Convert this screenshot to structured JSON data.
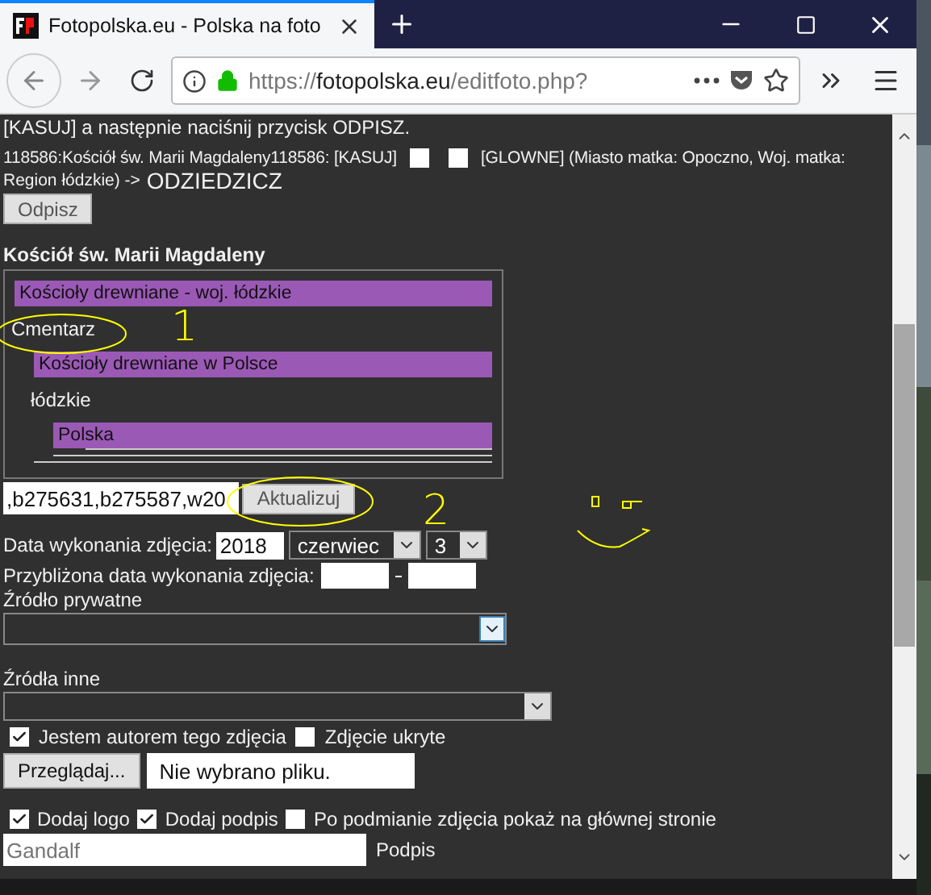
{
  "browser": {
    "tab_title": "Fotopolska.eu - Polska na foto",
    "url": {
      "scheme": "https://",
      "domain": "fotopolska.eu",
      "path": "/editfoto.php?"
    }
  },
  "page": {
    "intro_line": "[KASUJ] a następnie naciśnij przycisk ODPISZ.",
    "record": {
      "text": "118586:Kościół św. Marii Magdaleny118586: [KASUJ]",
      "boxes": [
        {
          "checked": false
        },
        {
          "checked": false
        }
      ],
      "tail": "[GLOWNE] (Miasto matka: Opoczno, Woj. matka:",
      "tail_2": "Region łódzkie) ->",
      "link": "ODZIEDZICZ"
    },
    "odpisz_button": "Odpisz",
    "heading": "Kościół św. Marii Magdaleny",
    "categories": [
      {
        "label": "Kościoły drewniane - woj. łódzkie",
        "note": "Cmentarz",
        "children": [
          {
            "label": "Kościoły drewniane w Polsce",
            "note": "łódzkie",
            "children": [
              {
                "label": "Polska"
              }
            ]
          }
        ]
      }
    ],
    "codes_field": {
      "value": ",b275631,b275587,w20"
    },
    "update_button": "Aktualizuj",
    "date": {
      "label": "Data wykonania zdjęcia:",
      "year": "2018",
      "month": "czerwiec",
      "day": "3"
    },
    "approx_date": {
      "label": "Przybliżona data wykonania zdjęcia:"
    },
    "private_source": {
      "label": "Źródło prywatne"
    },
    "other_sources": {
      "label": "Źródła inne"
    },
    "options1": [
      {
        "label": "Jestem autorem tego zdjęcia",
        "checked": true
      },
      {
        "label": "Zdjęcie ukryte",
        "checked": false
      }
    ],
    "file": {
      "button": "Przeglądaj...",
      "status": "Nie wybrano pliku."
    },
    "options2": [
      {
        "label": "Dodaj logo",
        "checked": true
      },
      {
        "label": "Dodaj podpis",
        "checked": true
      },
      {
        "label": "Po podmianie zdjęcia pokaż na głównej stronie",
        "checked": false
      }
    ],
    "signature": {
      "placeholder": "Gandalf",
      "label": "Podpis"
    }
  },
  "annotations": [
    {
      "kind": "ellipse"
    },
    {
      "kind": "number",
      "text": "1"
    },
    {
      "kind": "ellipse"
    },
    {
      "kind": "number",
      "text": "2"
    },
    {
      "kind": "smiley"
    }
  ]
}
